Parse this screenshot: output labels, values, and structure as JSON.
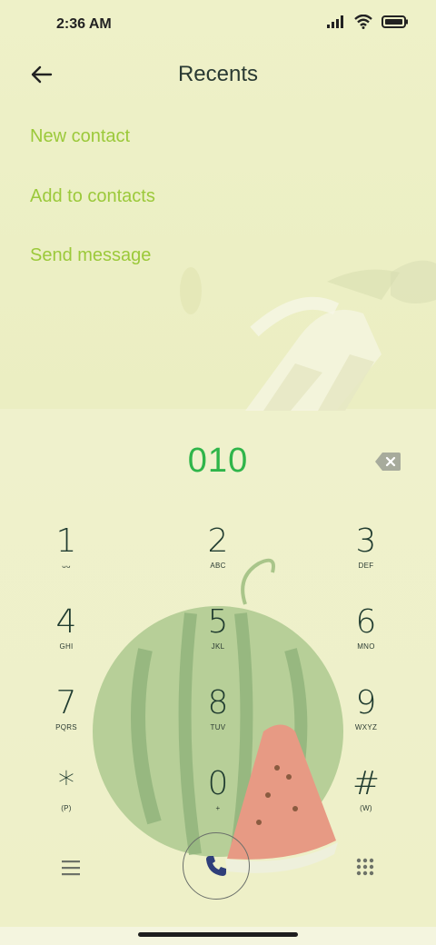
{
  "status": {
    "time": "2:36 AM",
    "icons": [
      "signal-icon",
      "wifi-icon",
      "battery-icon"
    ]
  },
  "header": {
    "title": "Recents",
    "back_icon": "back-arrow-icon"
  },
  "actions": [
    {
      "label": "New contact"
    },
    {
      "label": "Add to contacts"
    },
    {
      "label": "Send message"
    }
  ],
  "dialer": {
    "number": "010",
    "keys": [
      {
        "digit": "1",
        "letters": "ᴗᴗ"
      },
      {
        "digit": "2",
        "letters": "ABC"
      },
      {
        "digit": "3",
        "letters": "DEF"
      },
      {
        "digit": "4",
        "letters": "GHI"
      },
      {
        "digit": "5",
        "letters": "JKL"
      },
      {
        "digit": "6",
        "letters": "MNO"
      },
      {
        "digit": "7",
        "letters": "PQRS"
      },
      {
        "digit": "8",
        "letters": "TUV"
      },
      {
        "digit": "9",
        "letters": "WXYZ"
      },
      {
        "digit": "*",
        "letters": "(P)"
      },
      {
        "digit": "0",
        "letters": "+"
      },
      {
        "digit": "#",
        "letters": "(W)"
      }
    ]
  },
  "bottom": {
    "menu_icon": "menu-icon",
    "call_icon": "phone-icon",
    "dialpad_icon": "dialpad-icon"
  },
  "colors": {
    "accent": "#9bc93a",
    "number": "#2fb54a",
    "background": "#eef1c8"
  }
}
